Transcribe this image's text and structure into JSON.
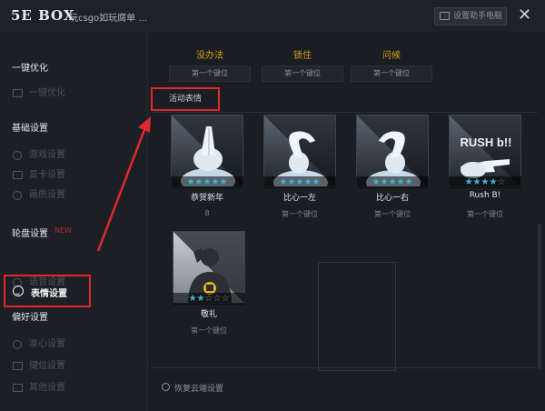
{
  "app": {
    "logo": "5E BOX",
    "title": "玩csgo如玩腐单 ...",
    "top_button": "设置助手电脑",
    "close": "✕"
  },
  "sidebar": {
    "sections": [
      {
        "title": "一键优化",
        "items": [
          "一键优化"
        ]
      },
      {
        "title": "基础设置",
        "items": [
          "游戏设置",
          "显卡设置",
          "画质设置"
        ]
      },
      {
        "title": "轮盘设置",
        "badge": "NEW",
        "items": [
          "表情设置",
          "语音设置"
        ]
      },
      {
        "title": "偏好设置",
        "items": [
          "准心设置",
          "键位设置",
          "其他设置"
        ]
      }
    ],
    "active_item": "表情设置"
  },
  "main": {
    "top_tabs": [
      {
        "name": "没办法",
        "sub": "第一个键位"
      },
      {
        "name": "锁住",
        "sub": "第一个键位"
      },
      {
        "name": "问候",
        "sub": "第一个键位"
      }
    ],
    "section_header": "活动表情",
    "cards": [
      {
        "name": "恭贺新年",
        "sub": "8",
        "stars": 5,
        "icon": "praying-hands-icon"
      },
      {
        "name": "比心一左",
        "sub": "第一个键位",
        "stars": 5,
        "icon": "heart-hand-left-icon"
      },
      {
        "name": "比心一右",
        "sub": "第一个键位",
        "stars": 5,
        "icon": "heart-hand-right-icon"
      },
      {
        "name": "Rush B!",
        "sub": "第一个键位",
        "stars": 4,
        "icon": "rush-b-icon",
        "banner": "RUSH b!!"
      },
      {
        "name": "敬礼",
        "sub": "第一个键位",
        "stars": 2,
        "icon": "salute-icon"
      }
    ],
    "footer_link": "恢复云端设置"
  },
  "colors": {
    "accent_gold": "#d4a017",
    "highlight_red": "#e0282f",
    "star_blue": "#3bb7d4"
  }
}
